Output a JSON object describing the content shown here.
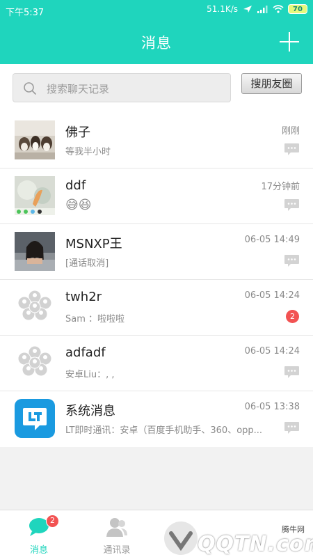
{
  "status_bar": {
    "time": "下午5:37",
    "speed": "51.1K/s",
    "battery": "70"
  },
  "header": {
    "title": "消息",
    "add_icon": "plus-icon"
  },
  "search": {
    "placeholder": "搜索聊天记录",
    "button": "搜朋友圈"
  },
  "conversations": [
    {
      "name": "佛子",
      "message": "等我半小时",
      "time": "刚刚",
      "indicator": "bubble"
    },
    {
      "name": "ddf",
      "message": "😅😆",
      "time": "17分钟前",
      "indicator": "bubble"
    },
    {
      "name": "MSNXP王",
      "message": "[通话取消]",
      "time": "06-05 14:49",
      "indicator": "bubble"
    },
    {
      "name": "twh2r",
      "message": "Sam ：啦啦啦",
      "time": "06-05 14:24",
      "indicator": "badge",
      "unread": "2"
    },
    {
      "name": "adfadf",
      "message": "安卓Liu：, ,",
      "time": "06-05 14:24",
      "indicator": "bubble"
    },
    {
      "name": "系统消息",
      "message": "LT即时通讯：安卓（百度手机助手、360、opp...",
      "time": "06-05 13:38",
      "indicator": "bubble"
    }
  ],
  "tabs": [
    {
      "label": "消息",
      "badge": "2",
      "active": true
    },
    {
      "label": "通讯录",
      "active": false
    }
  ],
  "watermark": {
    "site": "腾牛网",
    "logo_text": "QQTN.com"
  },
  "colors": {
    "accent": "#1fd5bd",
    "badge": "#f25252",
    "active_tab": "#1fd5bd"
  }
}
